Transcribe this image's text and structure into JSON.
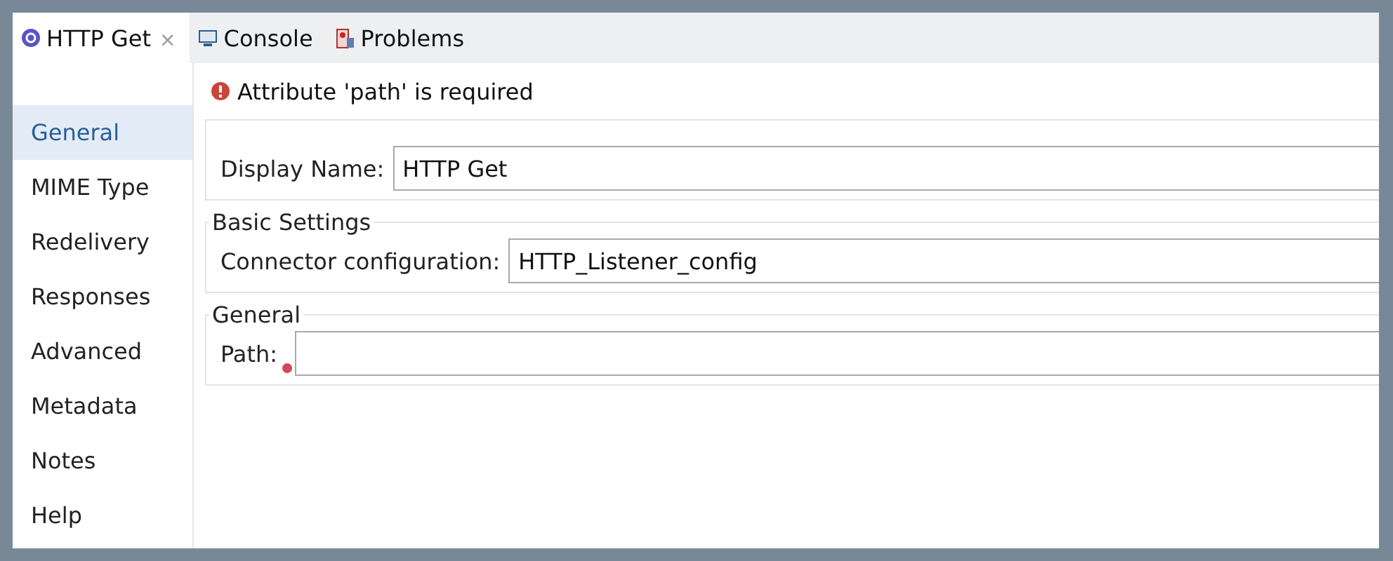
{
  "tabs": [
    {
      "label": "HTTP Get",
      "kind": "connector",
      "closable": true,
      "selected": true
    },
    {
      "label": "Console",
      "kind": "console",
      "closable": false,
      "selected": false
    },
    {
      "label": "Problems",
      "kind": "problems",
      "closable": false,
      "selected": false
    }
  ],
  "close_glyph": "×",
  "error_message": "Attribute 'path' is required",
  "sidebar": {
    "items": [
      {
        "label": "General",
        "selected": true
      },
      {
        "label": "MIME Type",
        "selected": false
      },
      {
        "label": "Redelivery",
        "selected": false
      },
      {
        "label": "Responses",
        "selected": false
      },
      {
        "label": "Advanced",
        "selected": false
      },
      {
        "label": "Metadata",
        "selected": false
      },
      {
        "label": "Notes",
        "selected": false
      },
      {
        "label": "Help",
        "selected": false
      }
    ]
  },
  "sections": [
    {
      "fields": [
        {
          "label": "Display Name:",
          "value": "HTTP Get",
          "error": false
        }
      ]
    },
    {
      "title": "Basic Settings",
      "fields": [
        {
          "label": "Connector configuration:",
          "value": "HTTP_Listener_config",
          "error": false
        }
      ]
    },
    {
      "title": "General",
      "fields": [
        {
          "label": "Path:",
          "error": true
        }
      ]
    }
  ]
}
